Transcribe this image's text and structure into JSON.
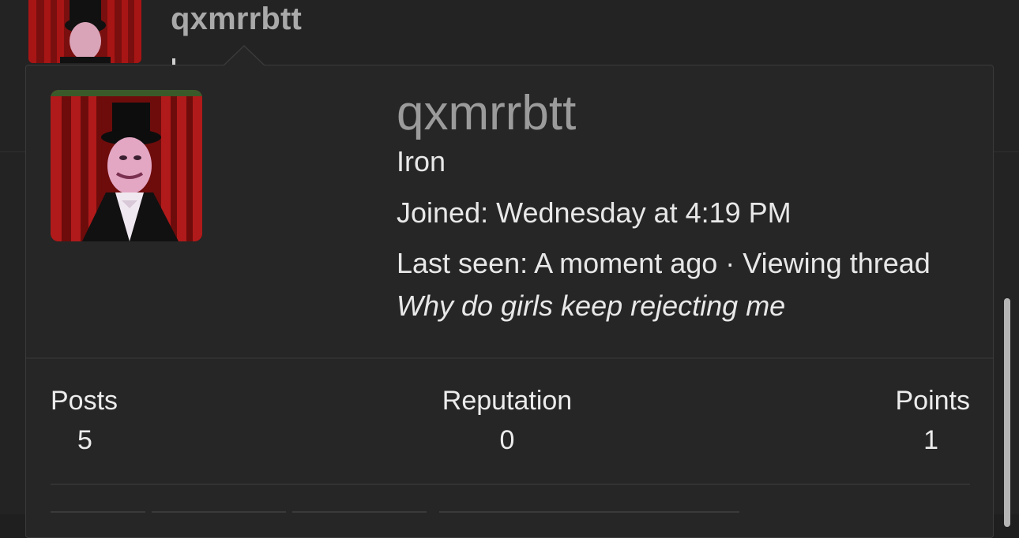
{
  "post": {
    "username": "qxmrrbtt",
    "avatar_label": "MR. ROBOT"
  },
  "tooltip": {
    "username": "qxmrrbtt",
    "user_title": "Iron",
    "joined_label": "Joined:",
    "joined_value": "Wednesday at 4:19 PM",
    "last_seen_label": "Last seen:",
    "last_seen_value": "A moment ago",
    "activity_prefix": "· Viewing thread",
    "activity_thread": "Why do girls keep rejecting me",
    "avatar_label": "MR. ROBOT",
    "stats": {
      "posts_label": "Posts",
      "posts_value": "5",
      "reputation_label": "Reputation",
      "reputation_value": "0",
      "points_label": "Points",
      "points_value": "1"
    }
  },
  "colors": {
    "background": "#1f1f1f",
    "card": "#262626",
    "username_muted": "#9b9b9b",
    "text": "#e8e8e8"
  }
}
